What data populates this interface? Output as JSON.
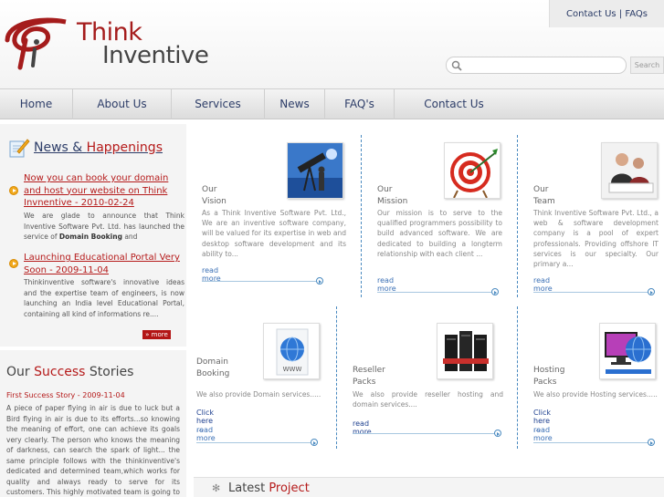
{
  "header": {
    "logo": {
      "think": "Think",
      "inventive": "Inventive"
    },
    "toplinks": {
      "contact": "Contact Us",
      "sep": " | ",
      "faqs": "FAQs"
    },
    "search": {
      "placeholder": "",
      "button": "Search"
    }
  },
  "nav": {
    "items": [
      "Home",
      "About Us",
      "Services",
      "News",
      "FAQ's",
      "Contact Us"
    ]
  },
  "news": {
    "heading_a": "News",
    "heading_amp": " & ",
    "heading_b": "Happenings",
    "items": [
      {
        "title": "Now you can book your domain and host your website on Think Invnentive - 2010-02-24",
        "body_pre": "We are glade to announce that Think Inventive Software Pvt. Ltd. has launched the service of ",
        "body_bold": "Domain Booking",
        "body_post": " and"
      },
      {
        "title": "Launching Educational Portal Very Soon - 2009-11-04",
        "body": "Thinkinventive software's innovative ideas and the expertise team of engineers, is now launching an India level Educational Portal, containing all kind of informations re...."
      }
    ],
    "more": "» more"
  },
  "success": {
    "heading_a": "Our ",
    "heading_b": "Success",
    "heading_c": " Stories",
    "title": "First Success Story - 2009-11-04",
    "body": "A piece of paper flying in air is due to luck but a Bird flying in air is due to its efforts...so knowing the meaning of effort, one can achieve its goals very clearly. The person who knows the meaning of darkness, can search the spark of light... the same principle follows with the thinkinventive's dedicated and determined team,which works for quality and always ready to serve for its customers. This highly motivated team is going to launch an Educational"
  },
  "cards_top": [
    {
      "title": "Our Vision",
      "text": "As a Think Inventive Software Pvt. Ltd., We are an inventive software company, will be valued for its expertise in web and desktop software development and its ability to...",
      "link": "read more",
      "image": "telescope-image"
    },
    {
      "title": "Our Mission",
      "text": "Our mission is to serve to the qualified programmers possibility to build advanced software. We are dedicated to building a longterm relationship with each client ...",
      "link": "read more",
      "image": "target-image"
    },
    {
      "title": "Our Team",
      "text": "Think Inventive Software Pvt. Ltd., a web & software development company is a pool of expert professionals. Providing offshore IT services is our specialty. Our primary a...",
      "link": "read more",
      "image": "team-image"
    }
  ],
  "cards_bottom": [
    {
      "title": "Domain Booking",
      "text": "We also provide Domain services.....",
      "click": "Click here ...",
      "link": "read more",
      "image": "www-globe-image"
    },
    {
      "title": "Reseller Packs",
      "text": "We also provide reseller hosting and domain services....",
      "click": "",
      "link": "read more",
      "image": "servers-image"
    },
    {
      "title": "Hosting Packs",
      "text": "We also provide Hosting services.....",
      "click": "Click here ...",
      "link": "read more",
      "image": "hosting-monitor-image"
    }
  ],
  "latest": {
    "heading_a": "Latest ",
    "heading_b": "Project"
  },
  "colors": {
    "brand_red": "#b51a1a",
    "nav_text": "#2d3d68",
    "link_blue": "#3a6fb5",
    "accent_orange": "#f0a81c"
  }
}
